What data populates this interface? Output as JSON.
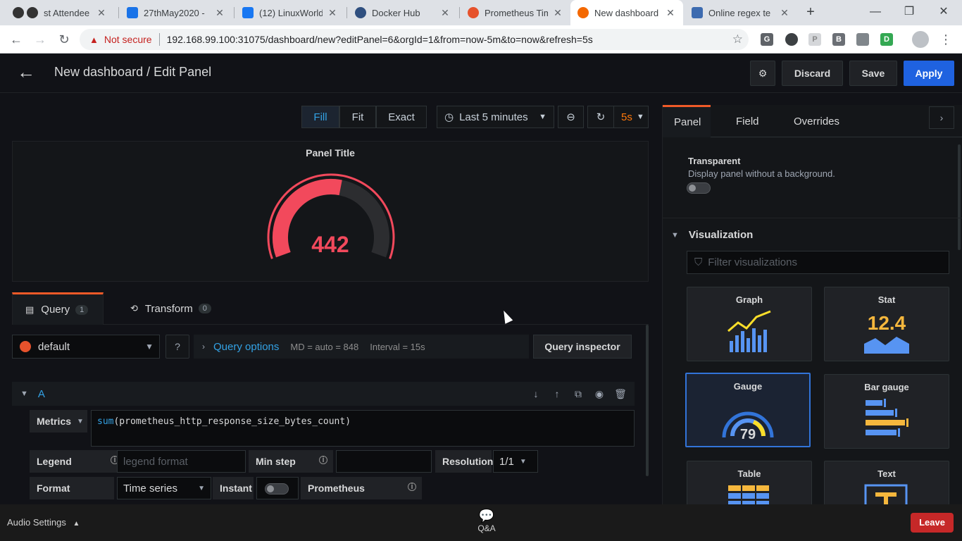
{
  "browser": {
    "tabs": [
      {
        "label": "st Attendee",
        "fav_color": "#444444"
      },
      {
        "label": "27thMay2020 -",
        "fav_color": "#1a73e8"
      },
      {
        "label": "(12) LinuxWorld",
        "fav_color": "#1877f2"
      },
      {
        "label": "Docker Hub",
        "fav_color": "#2f4f7f"
      },
      {
        "label": "Prometheus Tim",
        "fav_color": "#e6522c"
      },
      {
        "label": "New dashboard",
        "fav_color": "#f46800"
      },
      {
        "label": "Online regex te",
        "fav_color": "#3d6bb0"
      }
    ],
    "close_glyph": "✕",
    "new_tab": "+",
    "not_secure": "Not secure",
    "url": "192.168.99.100:31075/dashboard/new?editPanel=6&orgId=1&from=now-5m&to=now&refresh=5s",
    "extensions": [
      "G",
      "",
      "P",
      "B",
      "",
      "D"
    ]
  },
  "header": {
    "title": "New dashboard / Edit Panel",
    "discard": "Discard",
    "save": "Save",
    "apply": "Apply"
  },
  "toolbar": {
    "fill": "Fill",
    "fit": "Fit",
    "exact": "Exact",
    "time_range": "Last 5 minutes",
    "refresh_interval": "5s"
  },
  "panel": {
    "title": "Panel Title",
    "value": "442",
    "gauge_fraction": 0.55,
    "colors": {
      "value": "#f2495c",
      "track": "#2c2d30"
    }
  },
  "query_tabs": {
    "query_label": "Query",
    "query_count": "1",
    "transform_label": "Transform",
    "transform_count": "0"
  },
  "query": {
    "datasource": "default",
    "options_label": "Query options",
    "md": "MD = auto = 848",
    "interval": "Interval = 15s",
    "inspector": "Query inspector",
    "ref_id": "A",
    "metrics_label": "Metrics",
    "metrics_fn": "sum",
    "metrics_expr": "(prometheus_http_response_size_bytes_count)",
    "legend_label": "Legend",
    "legend_placeholder": "legend format",
    "min_step_label": "Min step",
    "resolution_label": "Resolution",
    "resolution_value": "1/1",
    "format_label": "Format",
    "format_value": "Time series",
    "instant_label": "Instant",
    "prometheus_label": "Prometheus"
  },
  "options": {
    "tabs": [
      "Panel",
      "Field",
      "Overrides"
    ],
    "transparent_title": "Transparent",
    "transparent_desc": "Display panel without a background.",
    "viz_heading": "Visualization",
    "filter_placeholder": "Filter visualizations",
    "cards": [
      {
        "name": "Graph",
        "icon": "graph-icon"
      },
      {
        "name": "Stat",
        "icon": "stat-icon",
        "sample": "12.4"
      },
      {
        "name": "Gauge",
        "icon": "gauge-icon",
        "sample": "79"
      },
      {
        "name": "Bar gauge",
        "icon": "bar-gauge-icon"
      },
      {
        "name": "Table",
        "icon": "table-icon"
      },
      {
        "name": "Text",
        "icon": "text-icon"
      }
    ]
  },
  "meeting": {
    "audio": "Audio Settings",
    "qa": "Q&A",
    "leave": "Leave"
  }
}
